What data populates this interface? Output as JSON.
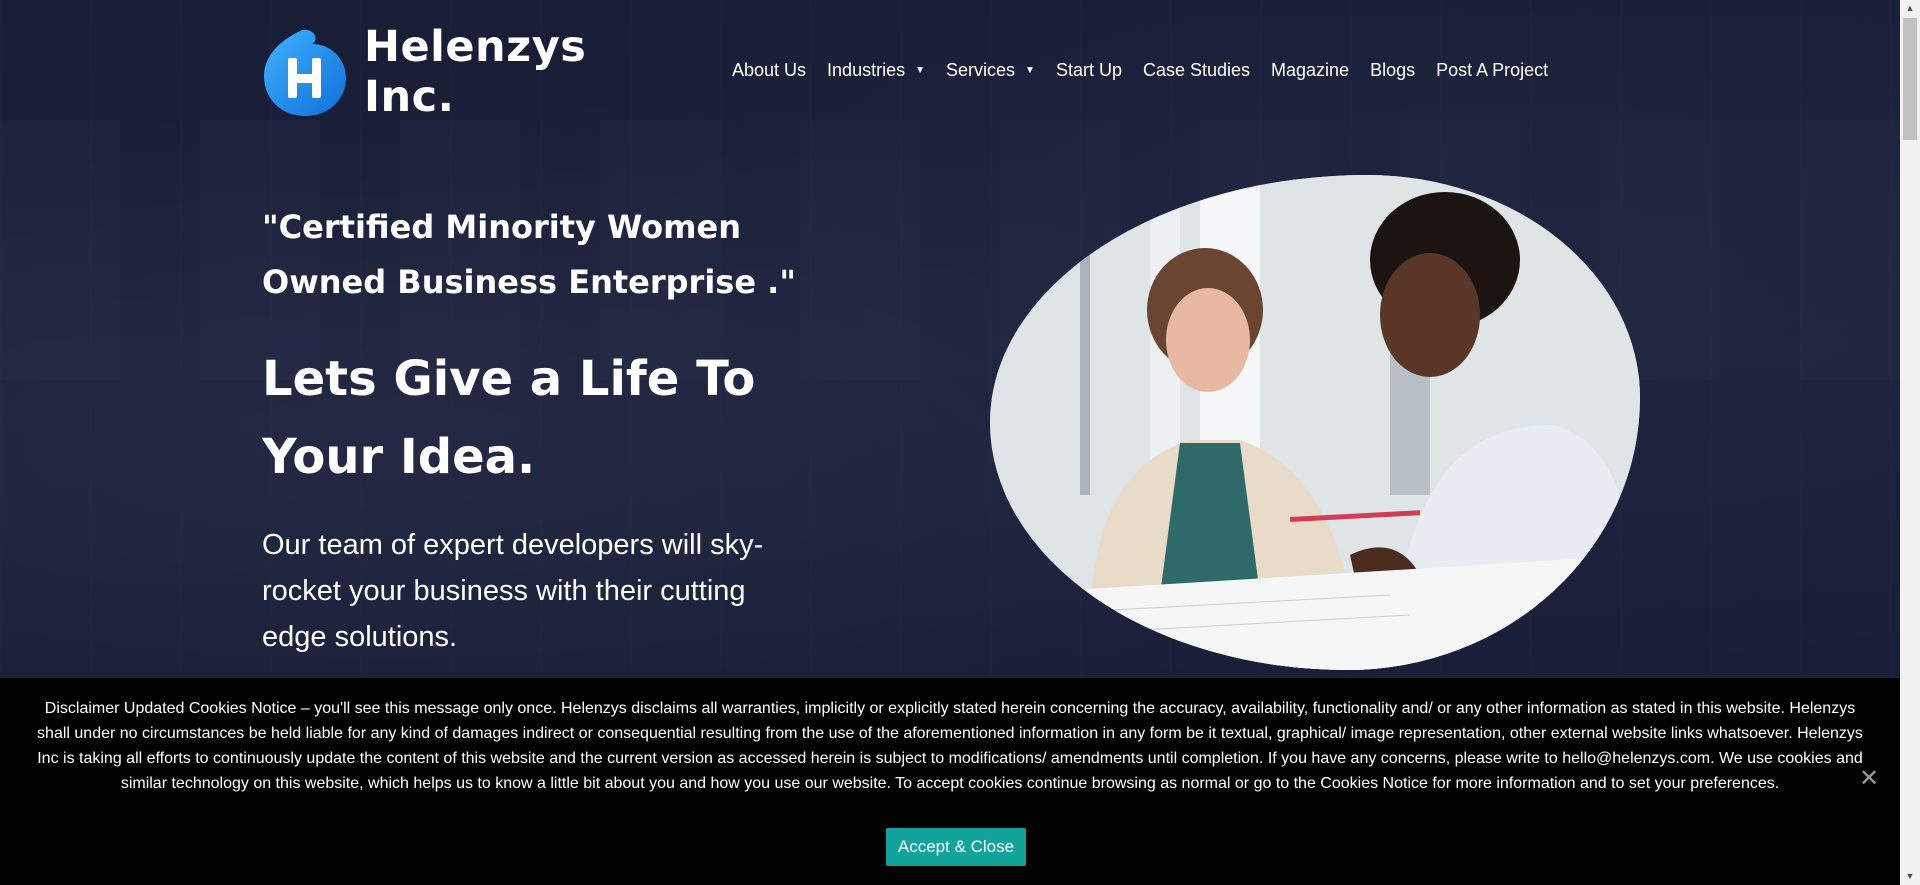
{
  "brand": {
    "name": "Helenzys Inc.",
    "logo_letter": "H",
    "logo_color": "#1f8bf0"
  },
  "nav": {
    "items": [
      {
        "label": "About Us",
        "has_dropdown": false
      },
      {
        "label": "Industries",
        "has_dropdown": true
      },
      {
        "label": "Services",
        "has_dropdown": true
      },
      {
        "label": "Start Up",
        "has_dropdown": false
      },
      {
        "label": "Case Studies",
        "has_dropdown": false
      },
      {
        "label": "Magazine",
        "has_dropdown": false
      },
      {
        "label": "Blogs",
        "has_dropdown": false
      },
      {
        "label": "Post A Project",
        "has_dropdown": false
      }
    ]
  },
  "hero": {
    "tagline": "\"Certified Minority Women Owned Business Enterprise .\"",
    "headline": "Lets Give a Life To Your Idea.",
    "subtext": "Our team of expert developers will sky-rocket your business with their cutting edge solutions."
  },
  "cookie": {
    "text": "Disclaimer Updated Cookies Notice – you'll see this message only once. Helenzys disclaims all warranties, implicitly or explicitly stated herein concerning the accuracy, availability, functionality and/ or any other information as stated in this website. Helenzys shall under no circumstances be held liable for any kind of damages indirect or consequential resulting from the use of the aforementioned information in any form be it textual, graphical/ image representation, other external website links whatsoever. Helenzys Inc is taking all efforts to continuously update the content of this website and the current version as accessed herein is subject to modifications/ amendments until completion. If you have any concerns, please write to hello@helenzys.com. We use cookies and similar technology on this website, which helps us to know a little bit about you and how you use our website. To accept cookies continue browsing as normal or go to the Cookies Notice for more information and to set your preferences.",
    "accept_label": "Accept & Close",
    "close_glyph": "✕",
    "accent_color": "#12a39a"
  },
  "icons": {
    "caret": "▼",
    "scroll_up": "▲",
    "scroll_down": "▼"
  }
}
